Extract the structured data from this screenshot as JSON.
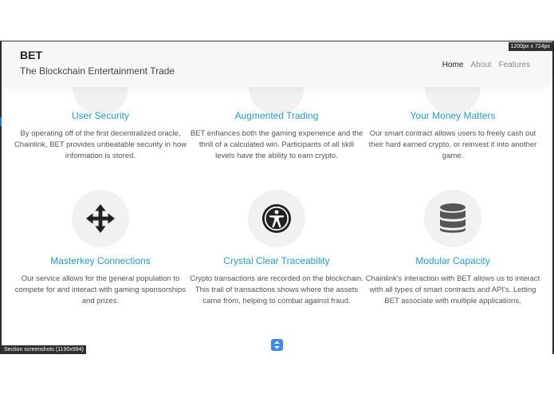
{
  "overlay": {
    "size_badge": "1200px x 724px",
    "caption": "Section screenshots (1190x994)"
  },
  "navbar": {
    "brand": "BET",
    "tagline": "The Blockchain Entertainment Trade",
    "links": [
      {
        "label": "Home",
        "active": true
      },
      {
        "label": "About",
        "active": false
      },
      {
        "label": "Features",
        "active": false
      }
    ]
  },
  "features_top": [
    {
      "title": "User Security",
      "text": "By operating off of the first decentralized oracle, Chainlink, BET provides unbeatable security in how information is stored."
    },
    {
      "title": "Augmented Trading",
      "text": "BET enhances both the gaming experience and the thrill of a calculated win. Participants of all skill levels have the ability to earn crypto."
    },
    {
      "title": "Your Money Matters",
      "text": "Our smart contract allows users to freely cash out their hard earned crypto, or reinvest it into another game."
    }
  ],
  "features_bottom": [
    {
      "icon": "arrows-move-icon",
      "title": "Masterkey Connections",
      "text": "Our service allows for the general population to compete for and interact with gaming sponsorships and prizes."
    },
    {
      "icon": "accessibility-icon",
      "title": "Crystal Clear Traceability",
      "text": "Crypto transactions are recorded on the blockchain. This trail of transactions shows where the assets came from, helping to combat against fraud."
    },
    {
      "icon": "database-icon",
      "title": "Modular Capacity",
      "text": "Chainlink's interaction with BET allows us to interact with all types of smart contracts and API's. Letting BET associate with multiple applications."
    }
  ],
  "colors": {
    "title_accent": "#27a0c7",
    "scroll_button": "#3d8bf2",
    "icon_dark": "#222222"
  }
}
